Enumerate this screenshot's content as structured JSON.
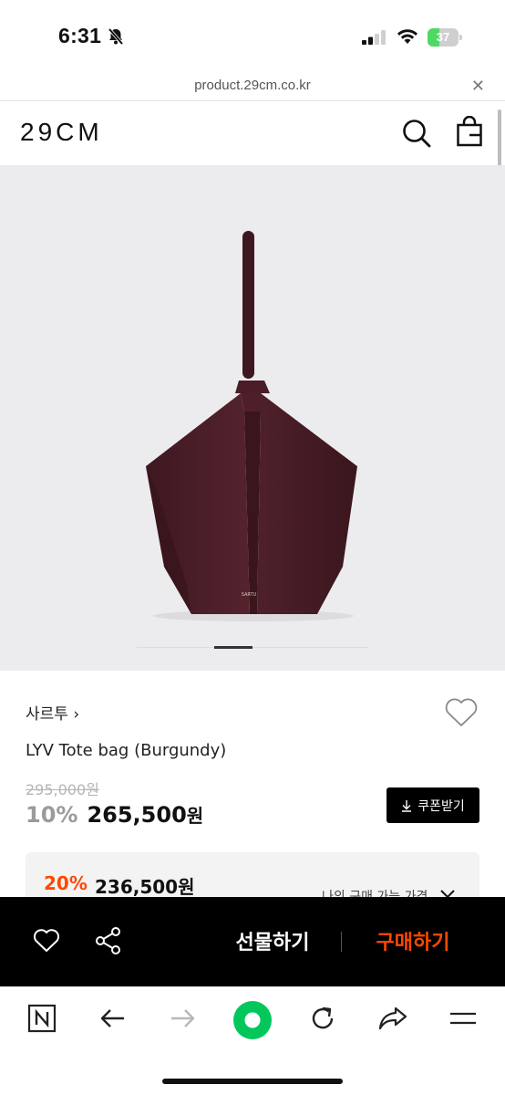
{
  "status": {
    "time": "6:31",
    "battery": "37",
    "battery_level": 0.37
  },
  "browser": {
    "url": "product.29cm.co.kr",
    "close_glyph": "✕"
  },
  "header": {
    "logo": "29CM",
    "icons": [
      "search-icon",
      "shopping-bag-icon"
    ]
  },
  "product_image": {
    "emboss": "SARTU",
    "slide_indicator": "1"
  },
  "product": {
    "brand": "사르투",
    "brand_chevron": "›",
    "name": "LYV Tote bag (Burgundy)",
    "original_price": "295,000원",
    "discount": "10%",
    "price": "265,500",
    "currency": "원",
    "coupon_label": "쿠폰받기"
  },
  "member_price": {
    "discount": "20%",
    "price": "236,500원",
    "link_label": "나의 구매 가능 가격"
  },
  "purchase_bar": {
    "gift_label": "선물하기",
    "buy_label": "구매하기",
    "accent_color": "#ff4800"
  },
  "toolbar": {
    "icons": [
      "naver-n-icon",
      "back-arrow-icon",
      "forward-arrow-icon",
      "green-dot-icon",
      "reload-icon",
      "share-icon",
      "menu-icon"
    ]
  },
  "colors": {
    "bag": "#4a1d27",
    "accent": "#ff4800",
    "naver_green": "#03c75a"
  }
}
